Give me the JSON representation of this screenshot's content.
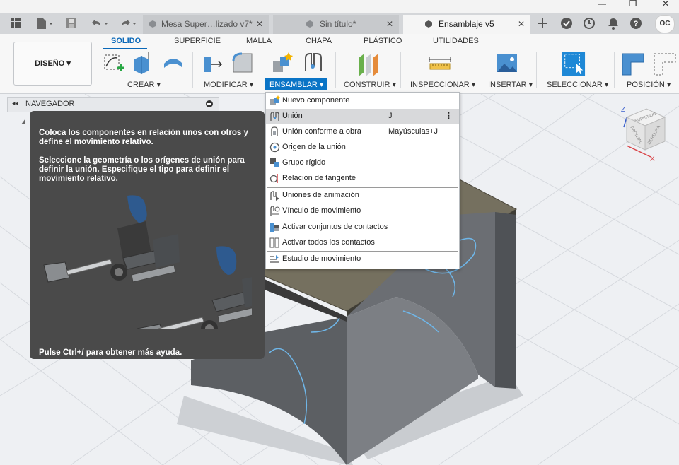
{
  "window": {
    "min": "—",
    "max": "❐",
    "close": "✕"
  },
  "tabs": [
    {
      "label": "Mesa Super…lizado v7*",
      "close": "✕"
    },
    {
      "label": "Sin título*",
      "close": "✕"
    },
    {
      "label": "Ensamblaje v5",
      "close": "✕"
    }
  ],
  "user": {
    "initials": "OC"
  },
  "ribbon": {
    "workspace": "DISEÑO ▾",
    "tabs": [
      "SOLIDO",
      "SUPERFICIE",
      "MALLA",
      "CHAPA",
      "PLÁSTICO",
      "UTILIDADES"
    ],
    "groups": [
      "CREAR ▾",
      "MODIFICAR ▾",
      "ENSAMBLAR ▾",
      "CONSTRUIR ▾",
      "INSPECCIONAR ▾",
      "INSERTAR ▾",
      "SELECCIONAR ▾",
      "POSICIÓN ▾"
    ]
  },
  "navigator": {
    "title": "NAVEGADOR",
    "collapse": "◂◂"
  },
  "tooltip": {
    "p1": "Coloca los componentes en relación unos con otros y define el movimiento relativo.",
    "p2": "Seleccione la geometría o los orígenes de unión para definir la unión. Especifique el tipo para definir el movimiento relativo.",
    "footer": "Pulse Ctrl+/ para obtener más ayuda."
  },
  "menu": {
    "items": [
      {
        "label": "Nuevo componente",
        "shortcut": ""
      },
      {
        "label": "Unión",
        "shortcut": "J"
      },
      {
        "label": "Unión conforme a obra",
        "shortcut": "Mayúsculas+J"
      },
      {
        "label": "Origen de la unión",
        "shortcut": ""
      },
      {
        "label": "Grupo rígido",
        "shortcut": ""
      },
      {
        "label": "Relación de tangente",
        "shortcut": ""
      },
      {
        "label": "Uniones de animación",
        "shortcut": ""
      },
      {
        "label": "Vínculo de movimiento",
        "shortcut": ""
      },
      {
        "label": "Activar conjuntos de contactos",
        "shortcut": ""
      },
      {
        "label": "Activar todos los contactos",
        "shortcut": ""
      },
      {
        "label": "Estudio de movimiento",
        "shortcut": ""
      }
    ],
    "more": "⋮"
  },
  "viewcube": {
    "top": "SUPERIOR",
    "front": "FRONTAL",
    "right": "DERECHA",
    "z": "Z",
    "x": "X"
  }
}
